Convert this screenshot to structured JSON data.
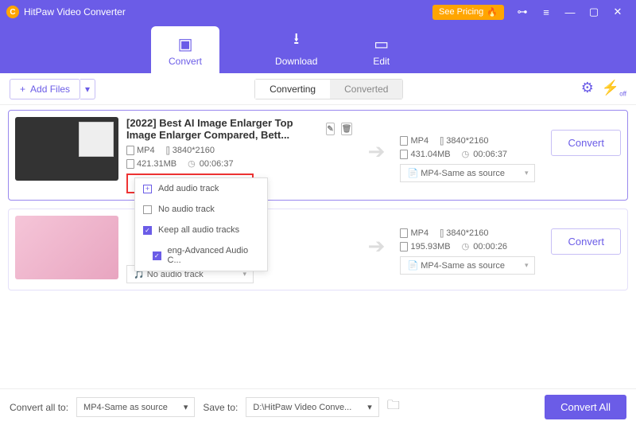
{
  "app": {
    "name": "HitPaw Video Converter",
    "pricing": "See Pricing"
  },
  "nav": {
    "convert": "Convert",
    "download": "Download",
    "edit": "Edit"
  },
  "toolbar": {
    "add_files": "Add Files",
    "converting": "Converting",
    "converted": "Converted",
    "gpu_off": "off"
  },
  "audio_dd": {
    "selected": "Keep all audio tracks",
    "opt_add": "Add audio track",
    "opt_none": "No audio track",
    "opt_keep": "Keep all audio tracks",
    "opt_eng": "eng-Advanced Audio C..."
  },
  "items": [
    {
      "title": "[2022] Best AI Image Enlarger Top Image Enlarger Compared, Bett...",
      "in_fmt": "MP4",
      "in_res": "3840*2160",
      "in_size": "421.31MB",
      "in_dur": "00:06:37",
      "out_fmt": "MP4",
      "out_res": "3840*2160",
      "out_size": "431.04MB",
      "out_dur": "00:06:37",
      "out_preset": "MP4-Same as source",
      "no_audio": "No audio track"
    },
    {
      "out_fmt": "MP4",
      "out_res": "3840*2160",
      "out_size": "195.93MB",
      "out_dur": "00:00:26",
      "out_preset": "MP4-Same as source",
      "no_audio": "No audio track"
    }
  ],
  "labels": {
    "convert": "Convert"
  },
  "footer": {
    "convert_all_to": "Convert all to:",
    "preset": "MP4-Same as source",
    "save_to": "Save to:",
    "path": "D:\\HitPaw Video Conve...",
    "convert_all": "Convert All"
  }
}
